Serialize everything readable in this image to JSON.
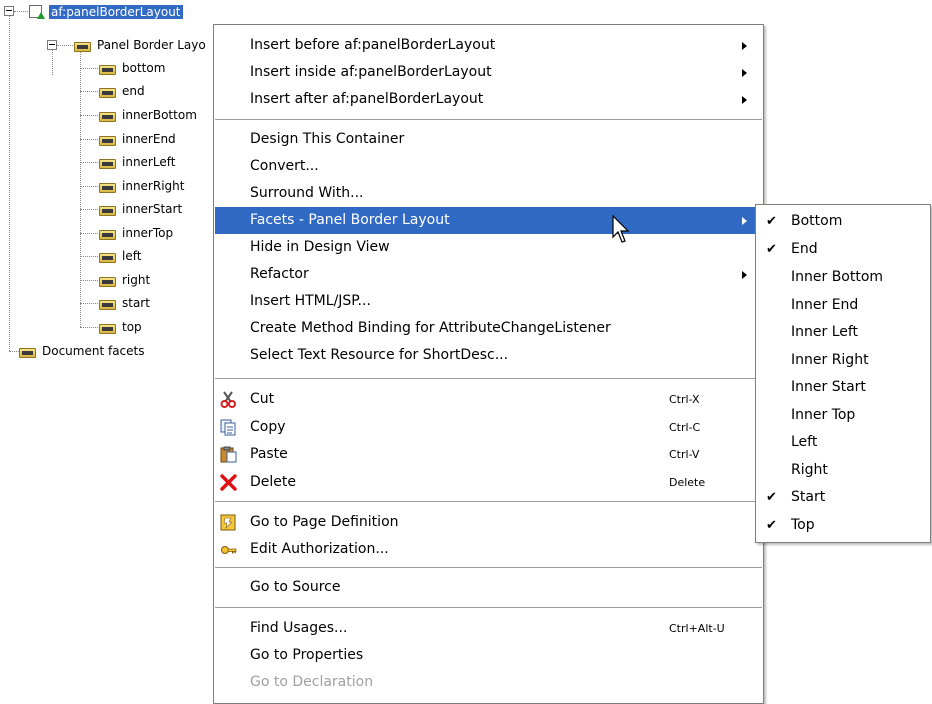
{
  "tree": {
    "root": {
      "label": "af:panelBorderLayout"
    },
    "child": {
      "label": "Panel Border Layo"
    },
    "facets": [
      {
        "label": "bottom"
      },
      {
        "label": "end"
      },
      {
        "label": "innerBottom"
      },
      {
        "label": "innerEnd"
      },
      {
        "label": "innerLeft"
      },
      {
        "label": "innerRight"
      },
      {
        "label": "innerStart"
      },
      {
        "label": "innerTop"
      },
      {
        "label": "left"
      },
      {
        "label": "right"
      },
      {
        "label": "start"
      },
      {
        "label": "top"
      }
    ],
    "document_facets": {
      "label": "Document facets"
    }
  },
  "context_menu": {
    "items": [
      {
        "label": "Insert before af:panelBorderLayout",
        "submenu": true
      },
      {
        "label": "Insert inside af:panelBorderLayout",
        "submenu": true
      },
      {
        "label": "Insert after af:panelBorderLayout",
        "submenu": true
      },
      {
        "label": "Design This Container"
      },
      {
        "label": "Convert..."
      },
      {
        "label": "Surround With..."
      },
      {
        "label": "Facets - Panel Border Layout",
        "submenu": true,
        "highlighted": true
      },
      {
        "label": "Hide in Design View"
      },
      {
        "label": "Refactor",
        "submenu": true
      },
      {
        "label": "Insert HTML/JSP..."
      },
      {
        "label": "Create Method Binding for AttributeChangeListener"
      },
      {
        "label": "Select Text Resource for ShortDesc..."
      },
      {
        "label": "Cut",
        "shortcut": "Ctrl-X",
        "icon": "scissors-icon"
      },
      {
        "label": "Copy",
        "shortcut": "Ctrl-C",
        "icon": "copy-icon"
      },
      {
        "label": "Paste",
        "shortcut": "Ctrl-V",
        "icon": "paste-icon"
      },
      {
        "label": "Delete",
        "shortcut": "Delete",
        "icon": "delete-icon"
      },
      {
        "label": "Go to Page Definition",
        "icon": "page-definition-icon"
      },
      {
        "label": "Edit Authorization...",
        "icon": "key-icon"
      },
      {
        "label": "Go to Source"
      },
      {
        "label": "Find Usages...",
        "shortcut": "Ctrl+Alt-U"
      },
      {
        "label": "Go to Properties"
      },
      {
        "label": "Go to Declaration",
        "disabled": true
      }
    ]
  },
  "facets_submenu": {
    "items": [
      {
        "label": "Bottom",
        "checked": true
      },
      {
        "label": "End",
        "checked": true
      },
      {
        "label": "Inner Bottom",
        "checked": false
      },
      {
        "label": "Inner End",
        "checked": false
      },
      {
        "label": "Inner Left",
        "checked": false
      },
      {
        "label": "Inner Right",
        "checked": false
      },
      {
        "label": "Inner Start",
        "checked": false
      },
      {
        "label": "Inner Top",
        "checked": false
      },
      {
        "label": "Left",
        "checked": false
      },
      {
        "label": "Right",
        "checked": false
      },
      {
        "label": "Start",
        "checked": true
      },
      {
        "label": "Top",
        "checked": true
      }
    ],
    "check_glyph": "✔"
  },
  "colors": {
    "highlight": "#316ac5",
    "disabled_text": "#a0a0a0"
  }
}
